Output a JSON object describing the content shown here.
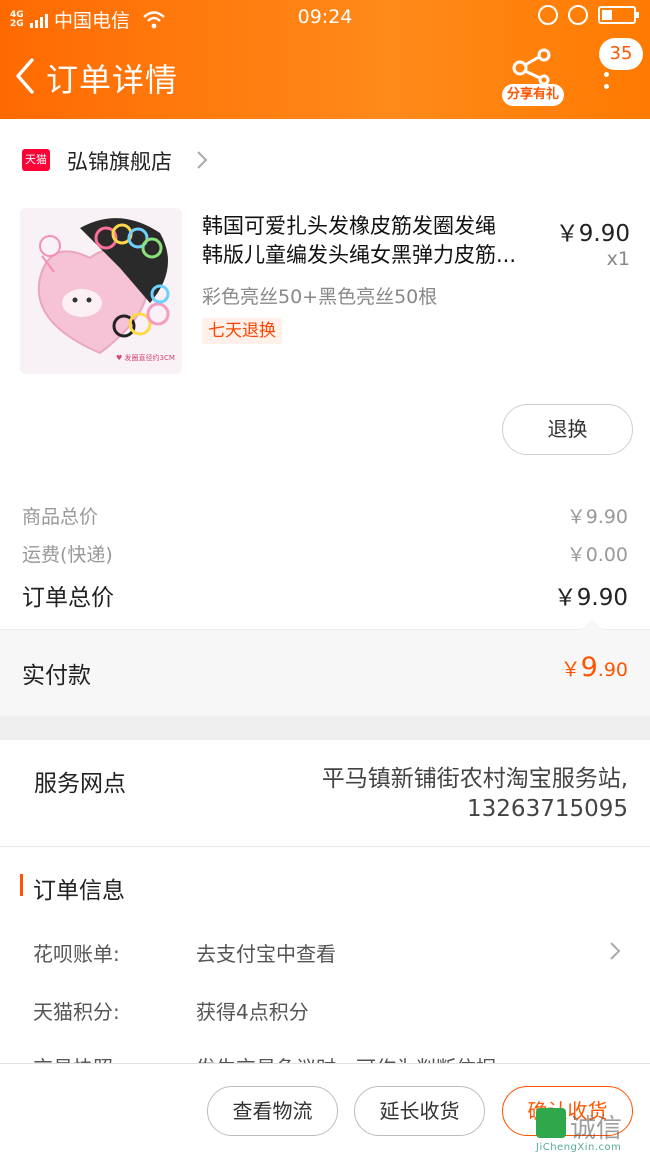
{
  "status_bar": {
    "network": "4G 2G",
    "carrier": "中国电信",
    "time": "09:24"
  },
  "header": {
    "title": "订单详情",
    "share_badge": "分享有礼",
    "message_count": "35"
  },
  "shop": {
    "platform_logo": "天猫",
    "name": "弘锦旗舰店"
  },
  "product": {
    "title_line1": "韩国可爱扎头发橡皮筋发圈发绳",
    "title_line2": "韩版儿童编发头绳女黑弹力皮筋...",
    "price": "￥9.90",
    "quantity": "x1",
    "sku": "彩色亮丝50+黑色亮丝50根",
    "return_tag": "七天退换",
    "image_caption": "♥ 发圈直径约3CM",
    "return_button": "退换"
  },
  "price_summary": {
    "goods_label": "商品总价",
    "goods_value": "￥9.90",
    "shipping_label": "运费(快递)",
    "shipping_value": "￥0.00",
    "total_label": "订单总价",
    "total_value": "￥9.90"
  },
  "payment": {
    "label": "实付款",
    "currency": "￥",
    "amount_int": "9",
    "amount_dec": ".90"
  },
  "service": {
    "label": "服务网点",
    "value_line1": "平马镇新铺街农村淘宝服务站,",
    "value_line2": "13263715095"
  },
  "order_info": {
    "heading": "订单信息",
    "rows": [
      {
        "key": "花呗账单:",
        "value": "去支付宝中查看"
      },
      {
        "key": "天猫积分:",
        "value": "获得4点积分"
      },
      {
        "key": "交易快照:",
        "value": "发生交易争议时，可作为判断依据"
      }
    ]
  },
  "footer": {
    "logistics_button": "查看物流",
    "extend_button": "延长收货",
    "confirm_button": "确认收货"
  },
  "watermark": {
    "text": "诚信",
    "url": "JiChengXin.com"
  },
  "colors": {
    "accent": "#ff5500",
    "header_start": "#ff6a00",
    "header_end": "#ff8a1a",
    "tmall_red": "#ff0036"
  }
}
